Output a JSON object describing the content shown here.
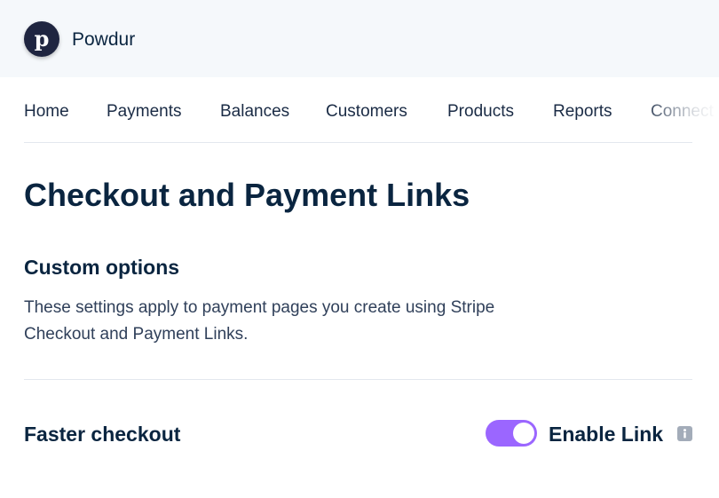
{
  "account": {
    "logo_letter": "p",
    "name": "Powdur"
  },
  "nav": {
    "items": [
      "Home",
      "Payments",
      "Balances",
      "Customers",
      "Products",
      "Reports",
      "Connect"
    ]
  },
  "page": {
    "title": "Checkout and Payment Links"
  },
  "section": {
    "title": "Custom options",
    "description": "These settings apply to payment pages you create using Stripe Checkout and Payment Links."
  },
  "setting": {
    "label": "Faster checkout",
    "toggle_label": "Enable Link",
    "toggle_on": true,
    "info_icon": "info-icon"
  },
  "colors": {
    "accent": "#9b66ff",
    "text_primary": "#0a2540",
    "header_bg": "#f5f8fb",
    "logo_bg": "#1f2540"
  }
}
